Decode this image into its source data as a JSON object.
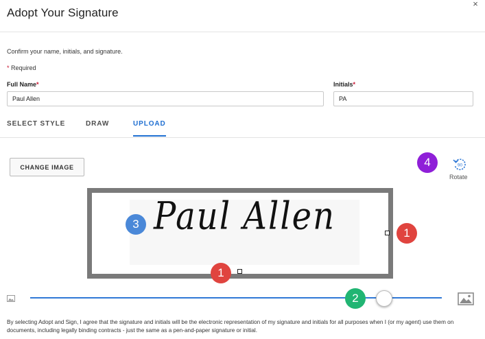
{
  "dialog": {
    "title": "Adopt Your Signature",
    "close_glyph": "×"
  },
  "form": {
    "confirm_text": "Confirm your name, initials, and signature.",
    "required_star": "*",
    "required_note": " Required",
    "full_name_label": "Full Name",
    "full_name_value": "Paul Allen",
    "initials_label": "Initials",
    "initials_value": "PA",
    "label_star": "*"
  },
  "tabs": [
    {
      "label": "SELECT STYLE",
      "active": false
    },
    {
      "label": "DRAW",
      "active": false
    },
    {
      "label": "UPLOAD",
      "active": true
    }
  ],
  "upload": {
    "change_image_label": "CHANGE IMAGE",
    "rotate_label": "Rotate",
    "rotate_icon_text": "90",
    "signature_text": "Paul Allen",
    "zoom_level": 0.86
  },
  "badges": {
    "red_right": "1",
    "red_bottom": "1",
    "blue": "3",
    "green": "2",
    "purple": "4"
  },
  "colors": {
    "accent": "#1f6fd1",
    "badge_red": "#e0443f",
    "badge_blue": "#4a88d8",
    "badge_green": "#21b573",
    "badge_purple": "#8f1fd8"
  },
  "icons": [
    "close-icon",
    "rotate-icon",
    "image-small-icon",
    "image-large-icon"
  ],
  "disclaimer": "By selecting Adopt and Sign, I agree that the signature and initials will be the electronic representation of my signature and initials for all purposes when I (or my agent) use them on documents, including legally binding contracts - just the same as a pen-and-paper signature or initial."
}
